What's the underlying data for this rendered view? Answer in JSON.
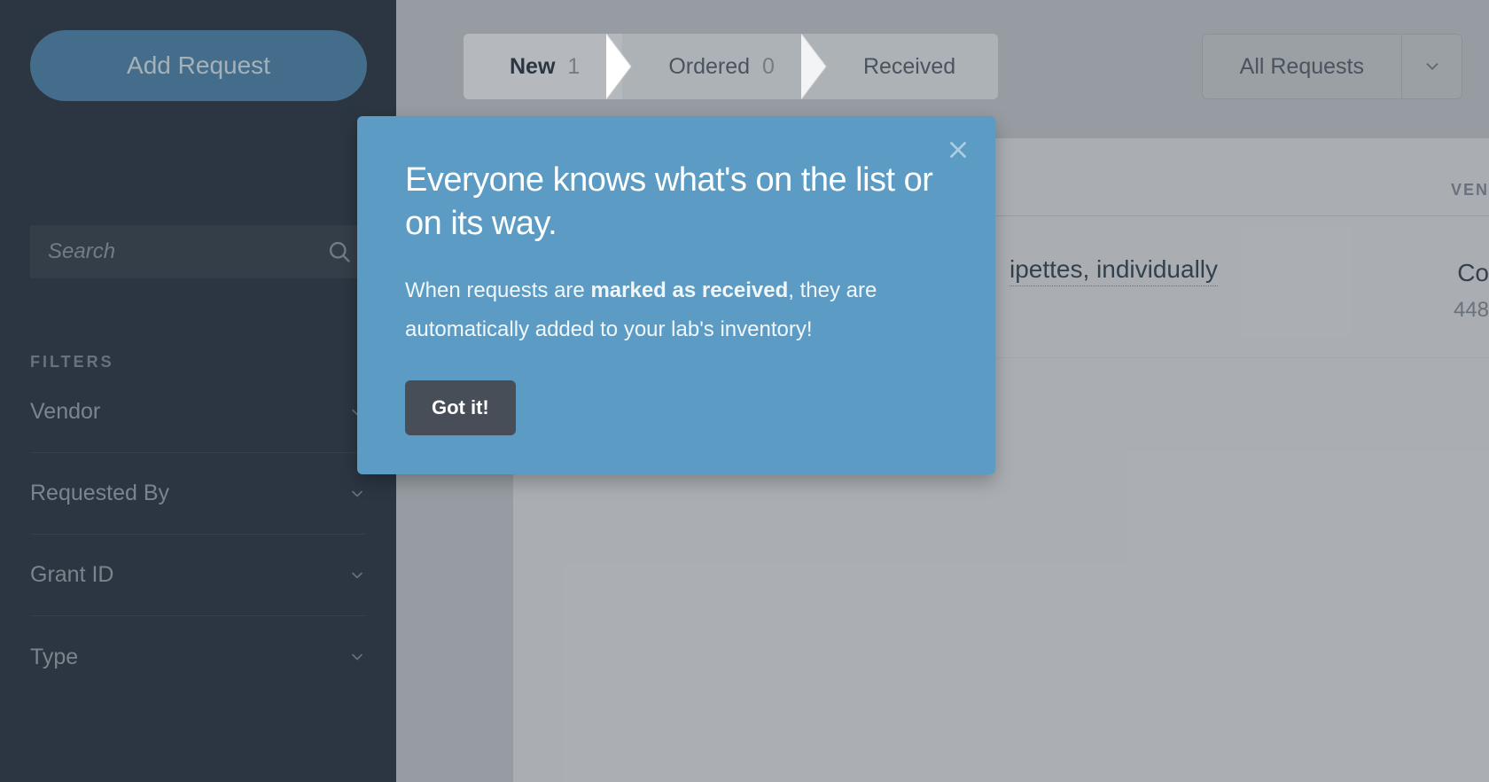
{
  "sidebar": {
    "add_request_label": "Add Request",
    "search_placeholder": "Search",
    "filters_heading": "FILTERS",
    "filters": [
      {
        "label": "Vendor"
      },
      {
        "label": "Requested By"
      },
      {
        "label": "Grant ID"
      },
      {
        "label": "Type"
      }
    ]
  },
  "status_tabs": [
    {
      "label": "New",
      "count": "1",
      "active": true
    },
    {
      "label": "Ordered",
      "count": "0",
      "active": false
    },
    {
      "label": "Received",
      "count": "",
      "active": false
    }
  ],
  "requests_dropdown": {
    "label": "All Requests"
  },
  "table": {
    "columns": {
      "vendor": "VEN"
    },
    "rows": [
      {
        "item_name_fragment": "ipettes, individually",
        "vendor_fragment": "Co",
        "vendor_sub_fragment": "448"
      }
    ]
  },
  "popover": {
    "title": "Everyone knows what's on the list or on its way.",
    "body_before": "When requests are ",
    "body_strong": "marked as received",
    "body_after": ", they are automatically added to your lab's inventory!",
    "button": "Got it!"
  },
  "colors": {
    "accent": "#5c9cc4",
    "sidebar_bg": "#2b3642"
  }
}
